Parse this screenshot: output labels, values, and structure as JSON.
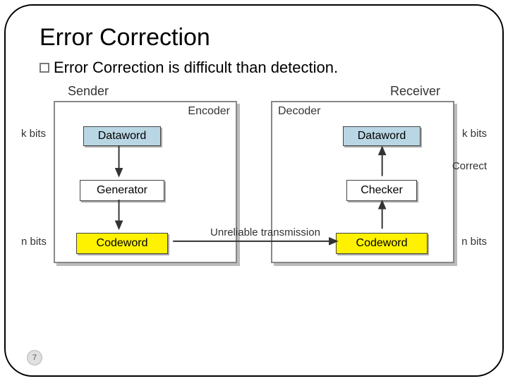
{
  "title": "Error Correction",
  "bullet": "Error Correction is difficult than detection.",
  "sender_label": "Sender",
  "receiver_label": "Receiver",
  "encoder_label": "Encoder",
  "decoder_label": "Decoder",
  "dataword": "Dataword",
  "generator": "Generator",
  "checker": "Checker",
  "codeword": "Codeword",
  "k_bits": "k bits",
  "n_bits": "n bits",
  "correct": "Correct",
  "unreliable": "Unreliable transmission",
  "page": "7"
}
